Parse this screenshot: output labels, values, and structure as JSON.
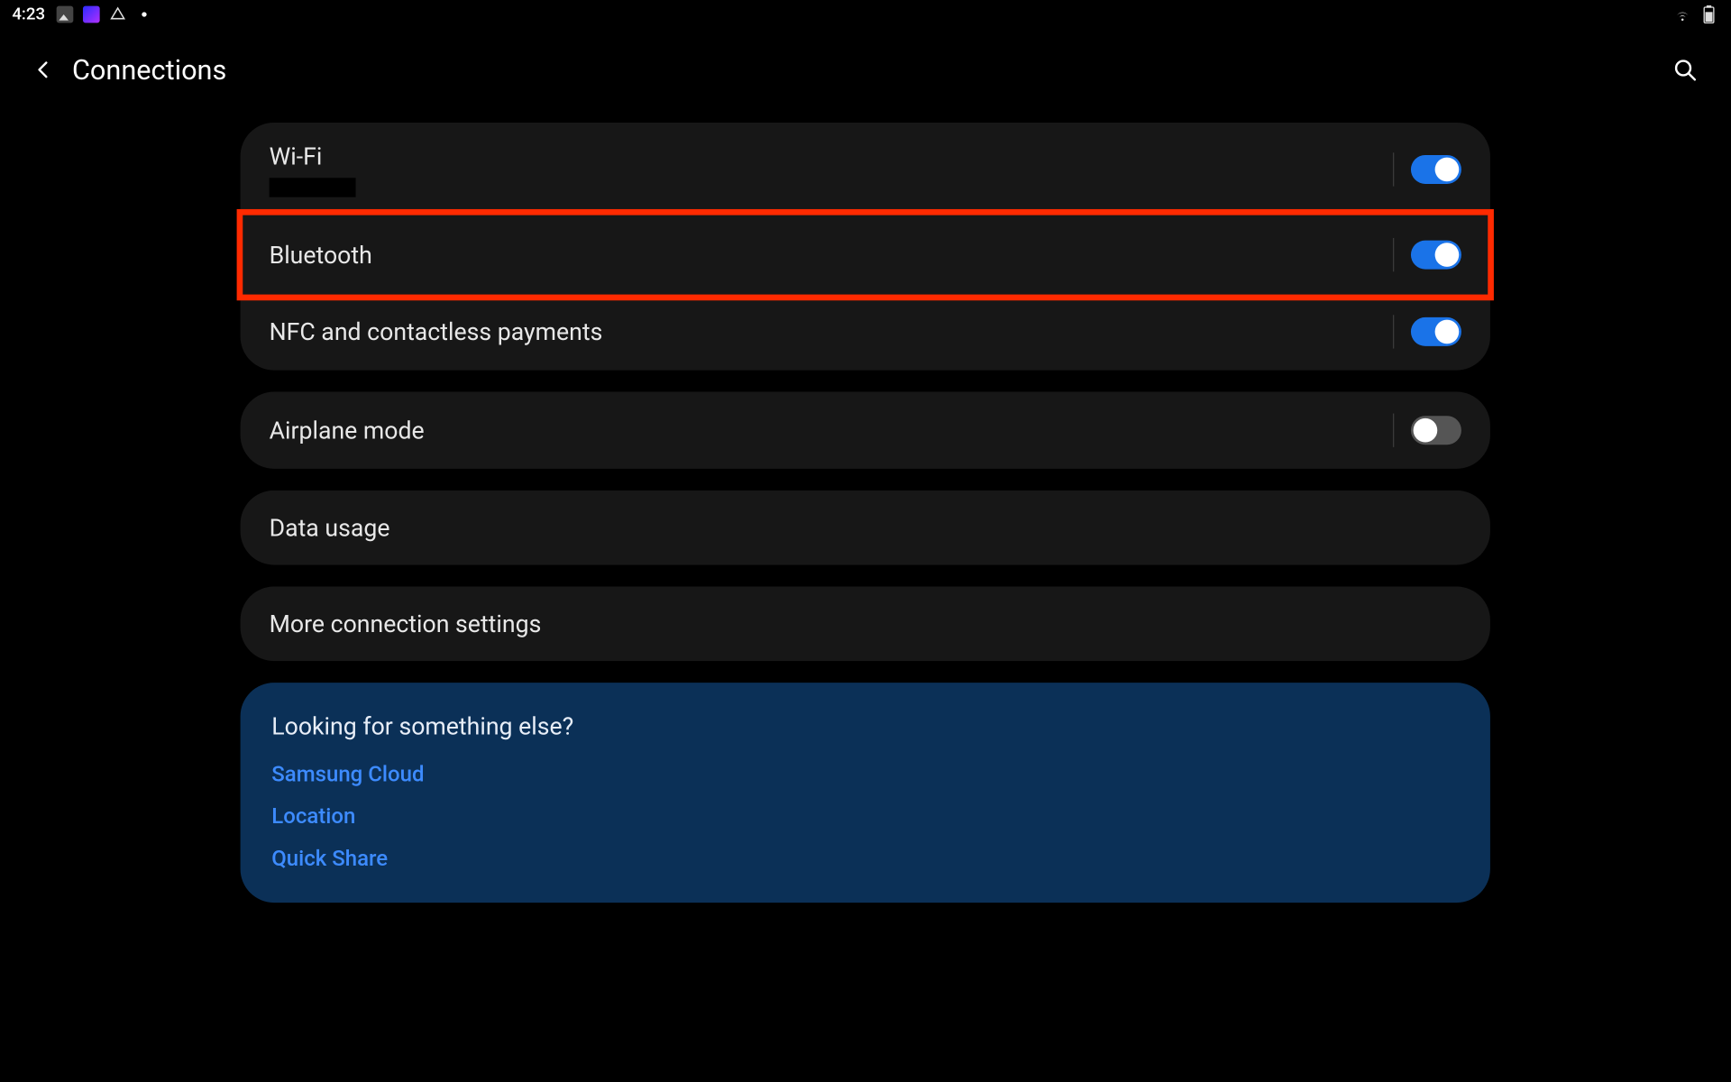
{
  "statusbar": {
    "time": "4:23"
  },
  "header": {
    "title": "Connections"
  },
  "rows": {
    "wifi": {
      "label": "Wi-Fi",
      "toggle": true
    },
    "bluetooth": {
      "label": "Bluetooth",
      "toggle": true
    },
    "nfc": {
      "label": "NFC and contactless payments",
      "toggle": true
    },
    "airplane": {
      "label": "Airplane mode",
      "toggle": false
    },
    "data": {
      "label": "Data usage"
    },
    "more": {
      "label": "More connection settings"
    }
  },
  "suggest": {
    "title": "Looking for something else?",
    "links": {
      "cloud": "Samsung Cloud",
      "location": "Location",
      "quickshare": "Quick Share"
    }
  },
  "highlight": {
    "target": "bluetooth"
  }
}
